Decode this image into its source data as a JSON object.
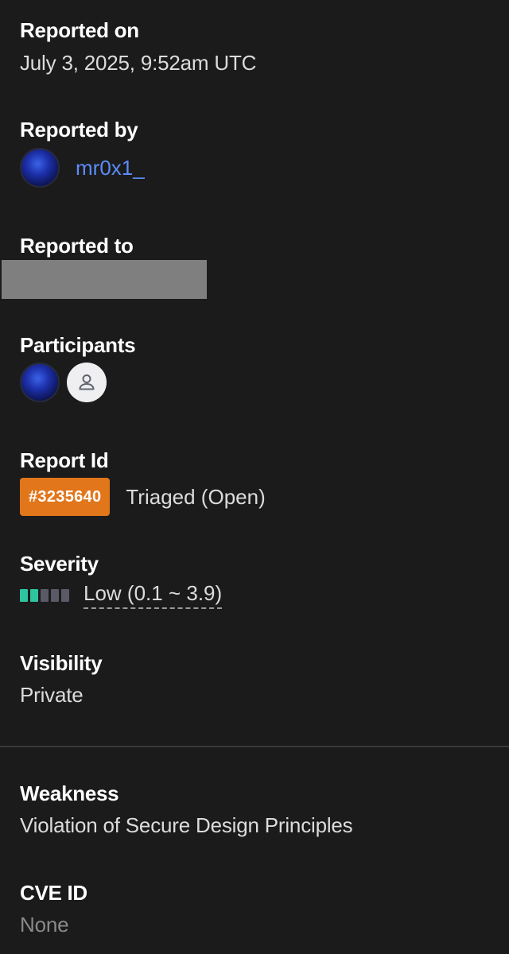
{
  "reported_on": {
    "label": "Reported on",
    "value": "July 3, 2025, 9:52am UTC"
  },
  "reported_by": {
    "label": "Reported by",
    "username": "mr0x1_"
  },
  "reported_to": {
    "label": "Reported to",
    "value_redacted": true
  },
  "participants": {
    "label": "Participants",
    "items": [
      "user-avatar",
      "default-user-icon"
    ]
  },
  "report_id": {
    "label": "Report Id",
    "badge": "#3235640",
    "status": "Triaged (Open)",
    "badge_color": "#e2761b"
  },
  "severity": {
    "label": "Severity",
    "text": "Low (0.1 ~ 3.9)",
    "level": 2,
    "max_level": 5,
    "color": "#2ec4a0"
  },
  "visibility": {
    "label": "Visibility",
    "value": "Private"
  },
  "weakness": {
    "label": "Weakness",
    "value": "Violation of Secure Design Principles"
  },
  "cve": {
    "label": "CVE ID",
    "value": "None"
  }
}
